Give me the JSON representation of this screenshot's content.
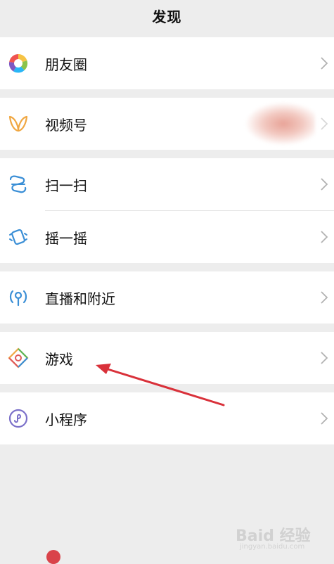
{
  "header": {
    "title": "发现"
  },
  "items": [
    {
      "label": "朋友圈"
    },
    {
      "label": "视频号"
    },
    {
      "label": "扫一扫"
    },
    {
      "label": "摇一摇"
    },
    {
      "label": "直播和附近"
    },
    {
      "label": "游戏"
    },
    {
      "label": "小程序"
    }
  ],
  "colors": {
    "background": "#ededed",
    "row": "#ffffff",
    "arrow": "#d9313a",
    "video_icon": "#f0a742",
    "scan_icon": "#3b8fd6",
    "mini_icon": "#7b70c9"
  },
  "watermark": {
    "main": "Baid 经验",
    "sub": "jingyan.baidu.com"
  }
}
